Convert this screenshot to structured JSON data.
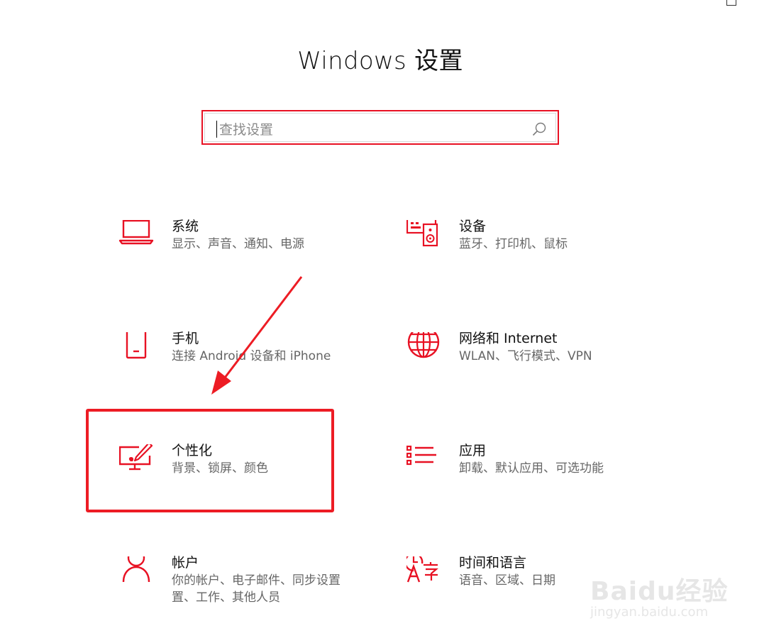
{
  "window": {
    "title": "Windows 设置"
  },
  "search": {
    "placeholder": "查找设置",
    "value": ""
  },
  "categories": [
    {
      "name": "系统",
      "desc": "显示、声音、通知、电源",
      "icon": "laptop-icon"
    },
    {
      "name": "设备",
      "desc": "蓝牙、打印机、鼠标",
      "icon": "devices-icon"
    },
    {
      "name": "手机",
      "desc": "连接 Android 设备和 iPhone",
      "icon": "phone-icon"
    },
    {
      "name": "网络和 Internet",
      "desc": "WLAN、飞行模式、VPN",
      "icon": "globe-icon"
    },
    {
      "name": "个性化",
      "desc": "背景、锁屏、颜色",
      "icon": "personalization-icon"
    },
    {
      "name": "应用",
      "desc": "卸载、默认应用、可选功能",
      "icon": "apps-list-icon"
    },
    {
      "name": "帐户",
      "desc": "你的帐户、电子邮件、同步设置\n置、工作、其他人员",
      "icon": "person-icon"
    },
    {
      "name": "时间和语言",
      "desc": "语音、区域、日期",
      "icon": "time-language-icon"
    }
  ],
  "watermark": {
    "logo": "Baidu经验",
    "url": "jingyan.baidu.com"
  },
  "colors": {
    "accent": "#e81123",
    "annotation": "#ed1c24",
    "text": "#111111",
    "subtext": "#666666"
  }
}
